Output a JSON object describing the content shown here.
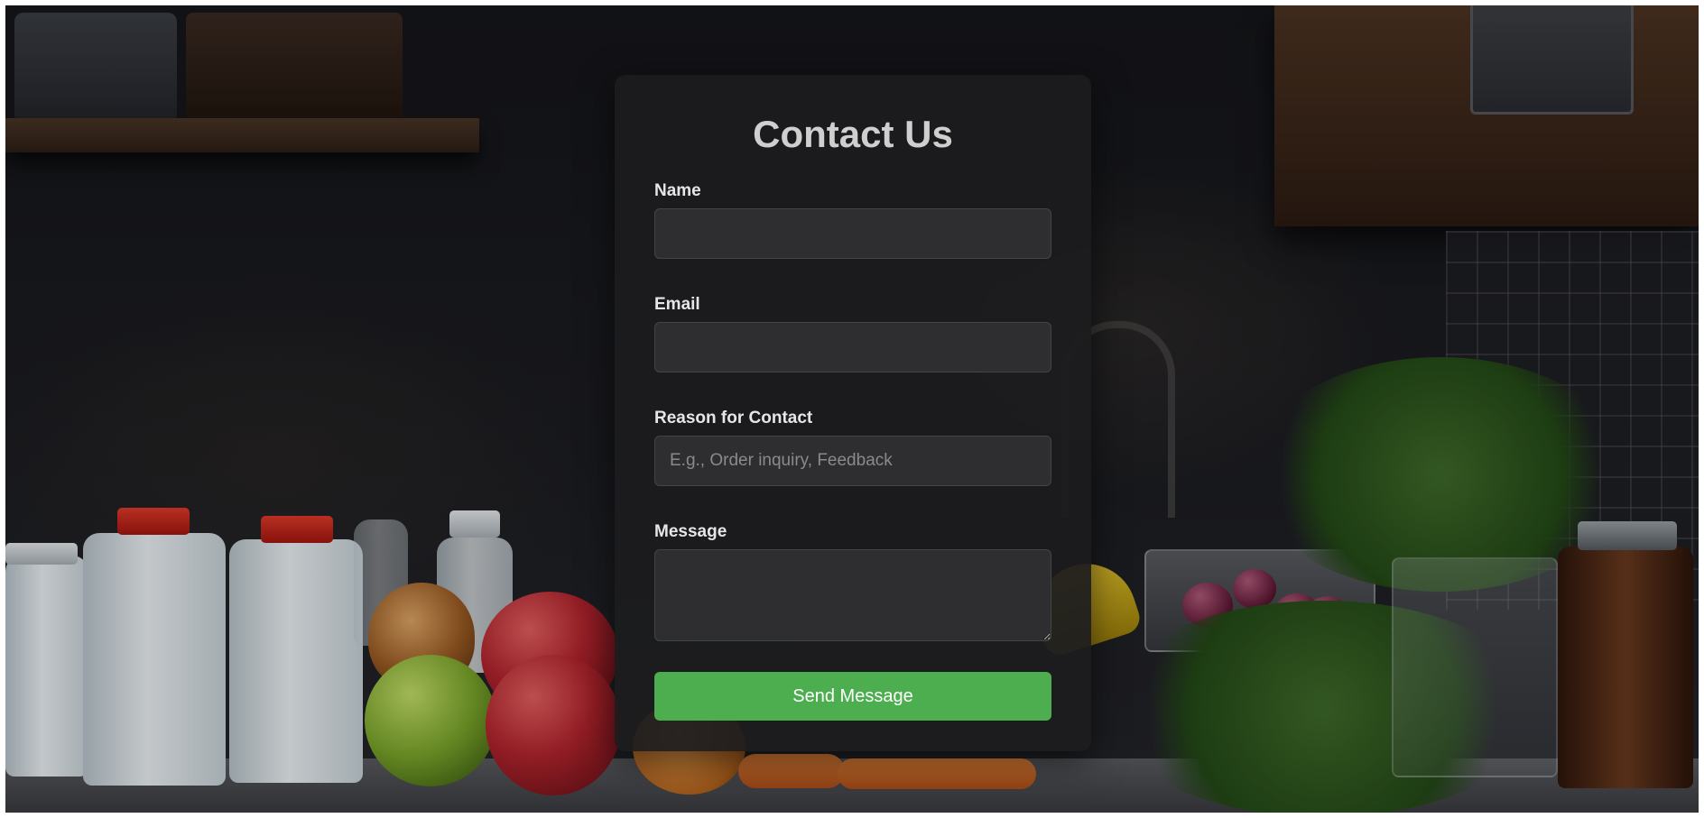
{
  "form": {
    "title": "Contact Us",
    "fields": {
      "name": {
        "label": "Name",
        "value": "",
        "placeholder": ""
      },
      "email": {
        "label": "Email",
        "value": "",
        "placeholder": ""
      },
      "reason": {
        "label": "Reason for Contact",
        "value": "",
        "placeholder": "E.g., Order inquiry, Feedback"
      },
      "message": {
        "label": "Message",
        "value": "",
        "placeholder": ""
      }
    },
    "submit_label": "Send Message"
  },
  "colors": {
    "card_background": "#1c1c1e",
    "input_background": "#2e2e30",
    "submit_button": "#4cae4f",
    "title_text": "#cfcfcf",
    "label_text": "#e6e6e6"
  }
}
